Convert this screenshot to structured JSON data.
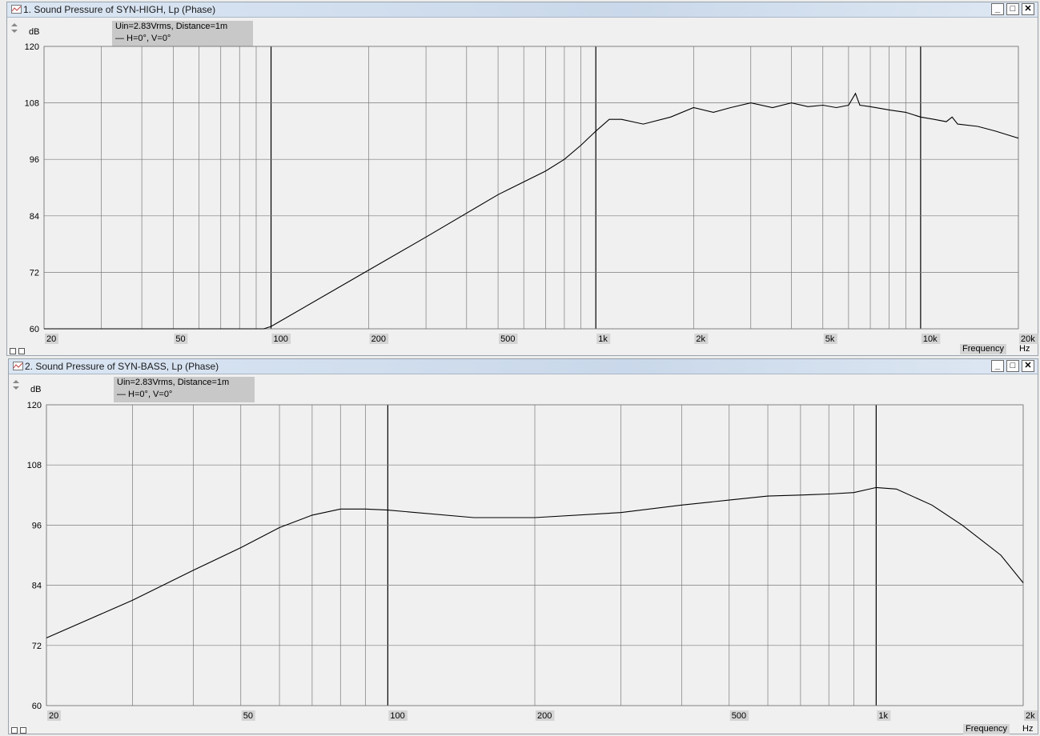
{
  "windows": [
    {
      "title": "1. Sound Pressure of SYN-HIGH, Lp (Phase)",
      "legend": [
        "Uin=2.83Vrms, Distance=1m",
        "— H=0°, V=0°"
      ]
    },
    {
      "title": "2. Sound Pressure of SYN-BASS, Lp (Phase)",
      "legend": [
        "Uin=2.83Vrms, Distance=1m",
        "— H=0°, V=0°"
      ]
    }
  ],
  "window_buttons": {
    "minimize": "_",
    "maximize": "□",
    "close": "✕"
  },
  "chart_data": [
    {
      "type": "line",
      "title": "1. Sound Pressure of SYN-HIGH, Lp (Phase)",
      "ylabel": "dB",
      "xlabel": "Frequency",
      "xunit": "Hz",
      "xscale": "log",
      "xlim": [
        20,
        20000
      ],
      "ylim": [
        60,
        120
      ],
      "yticks": [
        60,
        72,
        84,
        96,
        108,
        120
      ],
      "xtick_labels": [
        {
          "v": 20,
          "t": "20"
        },
        {
          "v": 50,
          "t": "50"
        },
        {
          "v": 100,
          "t": "100"
        },
        {
          "v": 200,
          "t": "200"
        },
        {
          "v": 500,
          "t": "500"
        },
        {
          "v": 1000,
          "t": "1k"
        },
        {
          "v": 2000,
          "t": "2k"
        },
        {
          "v": 5000,
          "t": "5k"
        },
        {
          "v": 10000,
          "t": "10k"
        },
        {
          "v": 20000,
          "t": "20k"
        }
      ],
      "grid": true,
      "series": [
        {
          "x": [
            20,
            95,
            100,
            200,
            300,
            500,
            700,
            800,
            900,
            1000,
            1100,
            1200,
            1400,
            1700,
            2000,
            2300,
            2600,
            3000,
            3500,
            4000,
            4500,
            5000,
            5500,
            6000,
            6300,
            6500,
            7000,
            8000,
            9000,
            10000,
            11000,
            12000,
            12500,
            13000,
            15000,
            17000,
            20000
          ],
          "y": [
            60,
            60,
            60.5,
            72.5,
            79.5,
            88.5,
            93.5,
            96,
            99,
            102,
            104.5,
            104.5,
            103.5,
            105,
            107,
            106,
            107,
            108,
            107,
            108,
            107.2,
            107.5,
            107,
            107.5,
            110,
            107.5,
            107.2,
            106.5,
            106,
            105,
            104.5,
            104,
            105,
            103.5,
            103,
            102,
            100.5
          ]
        }
      ]
    },
    {
      "type": "line",
      "title": "2. Sound Pressure of SYN-BASS, Lp (Phase)",
      "ylabel": "dB",
      "xlabel": "Frequency",
      "xunit": "Hz",
      "xscale": "log",
      "xlim": [
        20,
        2000
      ],
      "ylim": [
        60,
        120
      ],
      "yticks": [
        60,
        72,
        84,
        96,
        108,
        120
      ],
      "xtick_labels": [
        {
          "v": 20,
          "t": "20"
        },
        {
          "v": 50,
          "t": "50"
        },
        {
          "v": 100,
          "t": "100"
        },
        {
          "v": 200,
          "t": "200"
        },
        {
          "v": 500,
          "t": "500"
        },
        {
          "v": 1000,
          "t": "1k"
        },
        {
          "v": 2000,
          "t": "2k"
        }
      ],
      "grid": true,
      "series": [
        {
          "x": [
            20,
            30,
            40,
            50,
            60,
            70,
            80,
            90,
            100,
            150,
            200,
            300,
            400,
            500,
            600,
            700,
            800,
            900,
            1000,
            1100,
            1300,
            1500,
            1800,
            2000
          ],
          "y": [
            73.5,
            81,
            87,
            91.5,
            95.5,
            98,
            99.2,
            99.2,
            99,
            97.5,
            97.5,
            98.5,
            100,
            101,
            101.8,
            102,
            102.2,
            102.5,
            103.5,
            103.2,
            100,
            96,
            90,
            84.5
          ]
        }
      ]
    }
  ]
}
